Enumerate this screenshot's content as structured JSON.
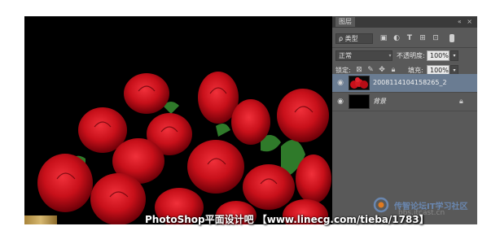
{
  "panel": {
    "tab_label": "图层",
    "window_controls": "« ×",
    "filter": {
      "kind_label": "ρ 类型",
      "icons": [
        "image-filter-icon",
        "adjustment-filter-icon",
        "type-filter-icon",
        "shape-filter-icon",
        "smart-object-filter-icon",
        "filter-toggle-icon"
      ]
    },
    "blend_mode": "正常",
    "opacity_label": "不透明度:",
    "opacity_value": "100%",
    "lock_label": "锁定:",
    "lock_icons": [
      "lock-transparent-icon",
      "lock-image-icon",
      "lock-position-icon",
      "lock-all-icon"
    ],
    "fill_label": "填充:",
    "fill_value": "100%",
    "layers": [
      {
        "name": "2008114104158265_2",
        "selected": true,
        "thumb": "roses"
      },
      {
        "name": "背景",
        "selected": false,
        "thumb": "black",
        "locked": true
      }
    ]
  },
  "watermark": {
    "text": "PhotoShop平面设计吧 【www.linecg.com/tieba/1783】"
  },
  "forum": {
    "name": "传智论坛IT学习社区",
    "url": "bbs.itcast.cn"
  },
  "colors": {
    "rose": "#c8101a",
    "rose_dark": "#7a0008",
    "leaf": "#2f7a2a",
    "selected_layer": "#6a7c92"
  }
}
